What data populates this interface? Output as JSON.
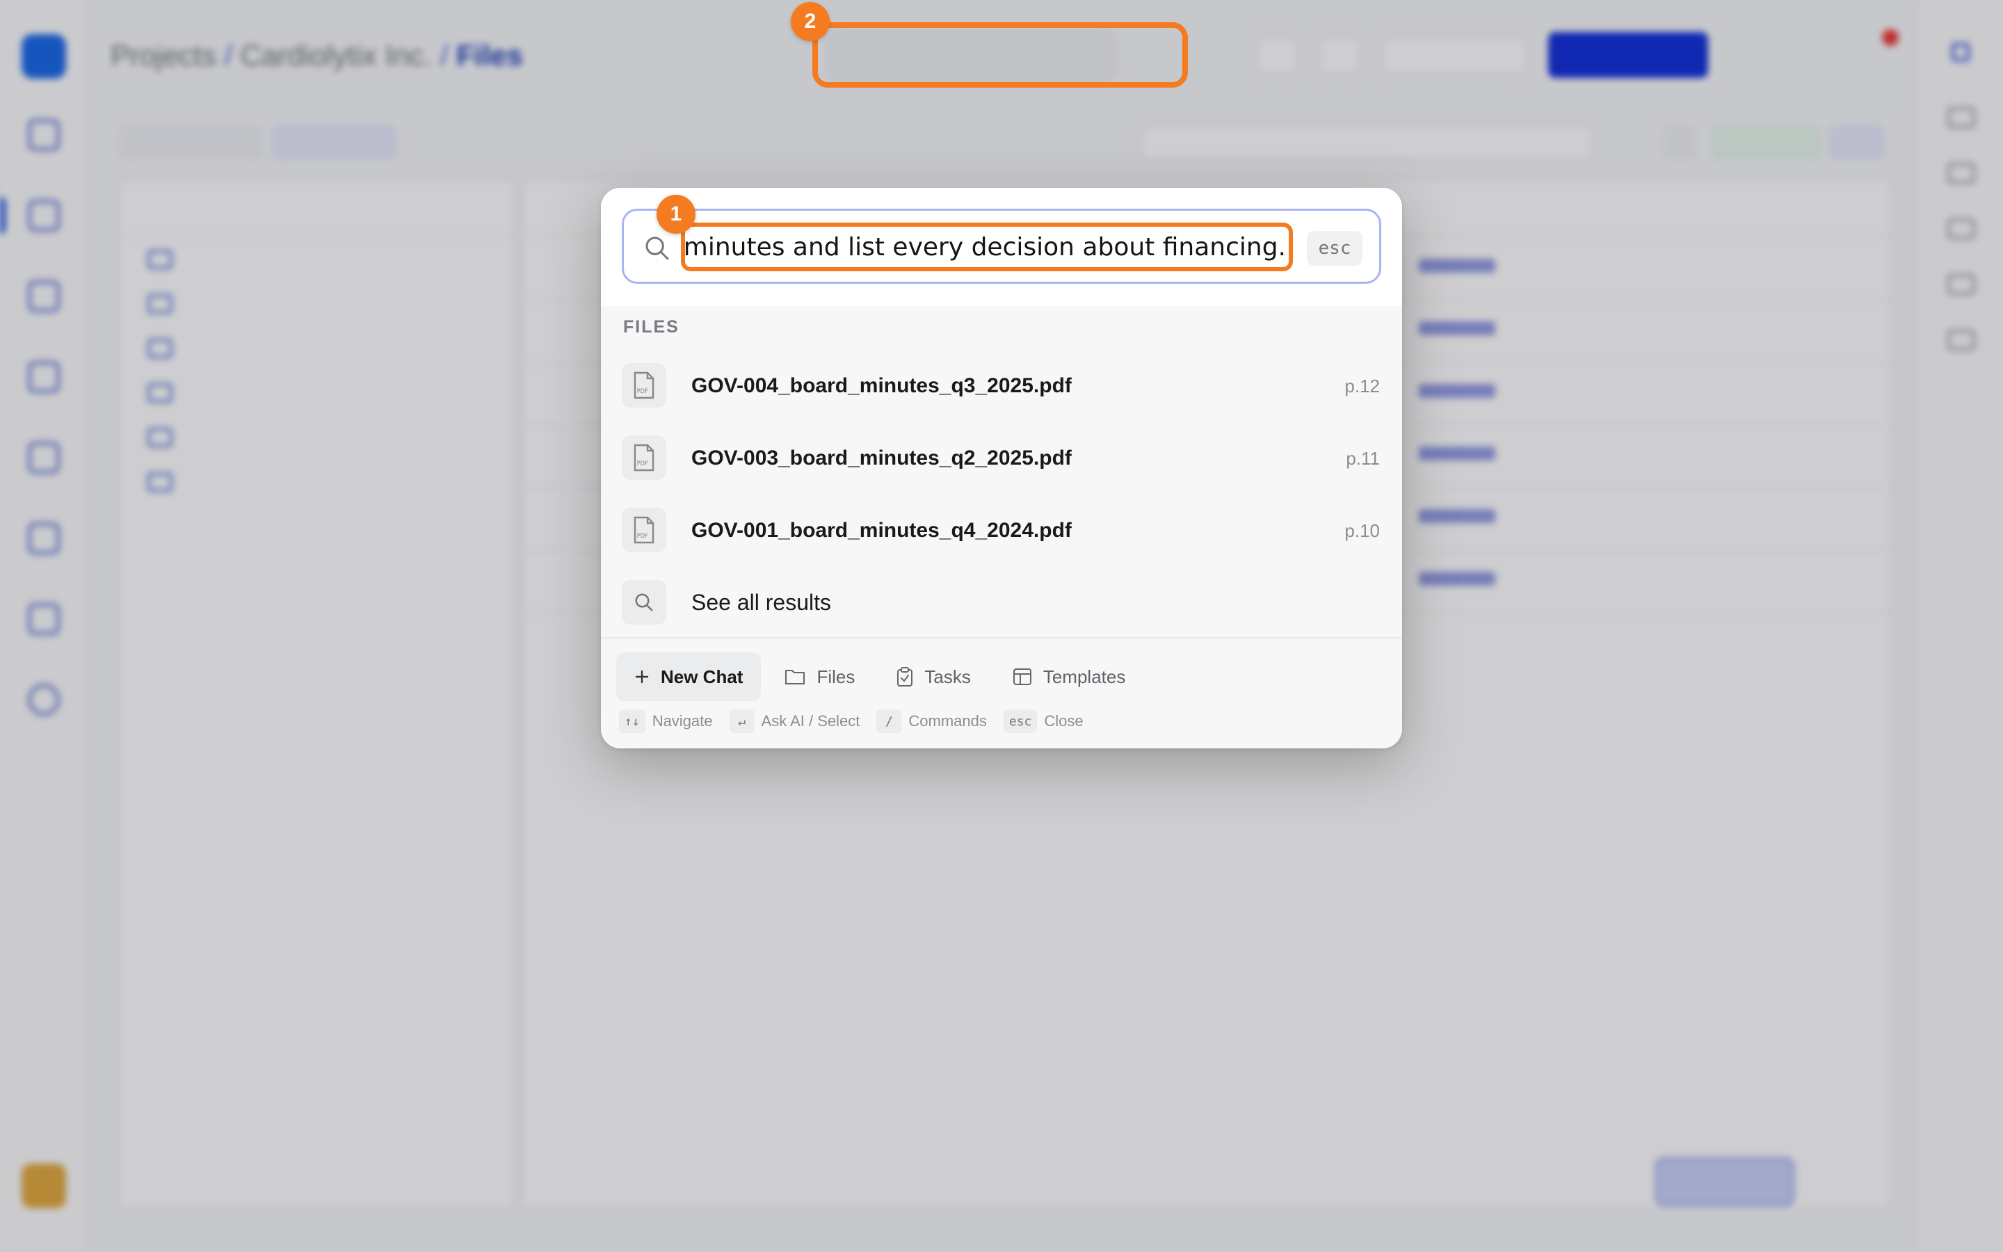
{
  "palette": {
    "query": "Read the board meeting minutes and list every decision about financing.",
    "esc_label": "esc",
    "section_title": "FILES",
    "results": [
      {
        "name": "GOV-004_board_minutes_q3_2025.pdf",
        "page": "p.12",
        "icon": "pdf-file-icon"
      },
      {
        "name": "GOV-003_board_minutes_q2_2025.pdf",
        "page": "p.11",
        "icon": "pdf-file-icon"
      },
      {
        "name": "GOV-001_board_minutes_q4_2024.pdf",
        "page": "p.10",
        "icon": "pdf-file-icon"
      }
    ],
    "see_all": "See all results",
    "tabs": [
      {
        "label": "New Chat",
        "icon": "plus-icon",
        "active": true
      },
      {
        "label": "Files",
        "icon": "folder-icon",
        "active": false
      },
      {
        "label": "Tasks",
        "icon": "clipboard-check-icon",
        "active": false
      },
      {
        "label": "Templates",
        "icon": "template-icon",
        "active": false
      }
    ],
    "hints": [
      {
        "key": "↑↓",
        "label": "Navigate"
      },
      {
        "key": "↵",
        "label": "Ask AI / Select"
      },
      {
        "key": "/",
        "label": "Commands"
      },
      {
        "key": "esc",
        "label": "Close"
      }
    ]
  },
  "markers": {
    "one": "1",
    "two": "2"
  },
  "background": {
    "crumbs": [
      "Projects",
      "Cardiolytix Inc.",
      "Files"
    ]
  },
  "colors": {
    "accent_orange": "#f47b1f",
    "primary_blue": "#0d2bd9",
    "search_border": "#a9b4f3"
  }
}
